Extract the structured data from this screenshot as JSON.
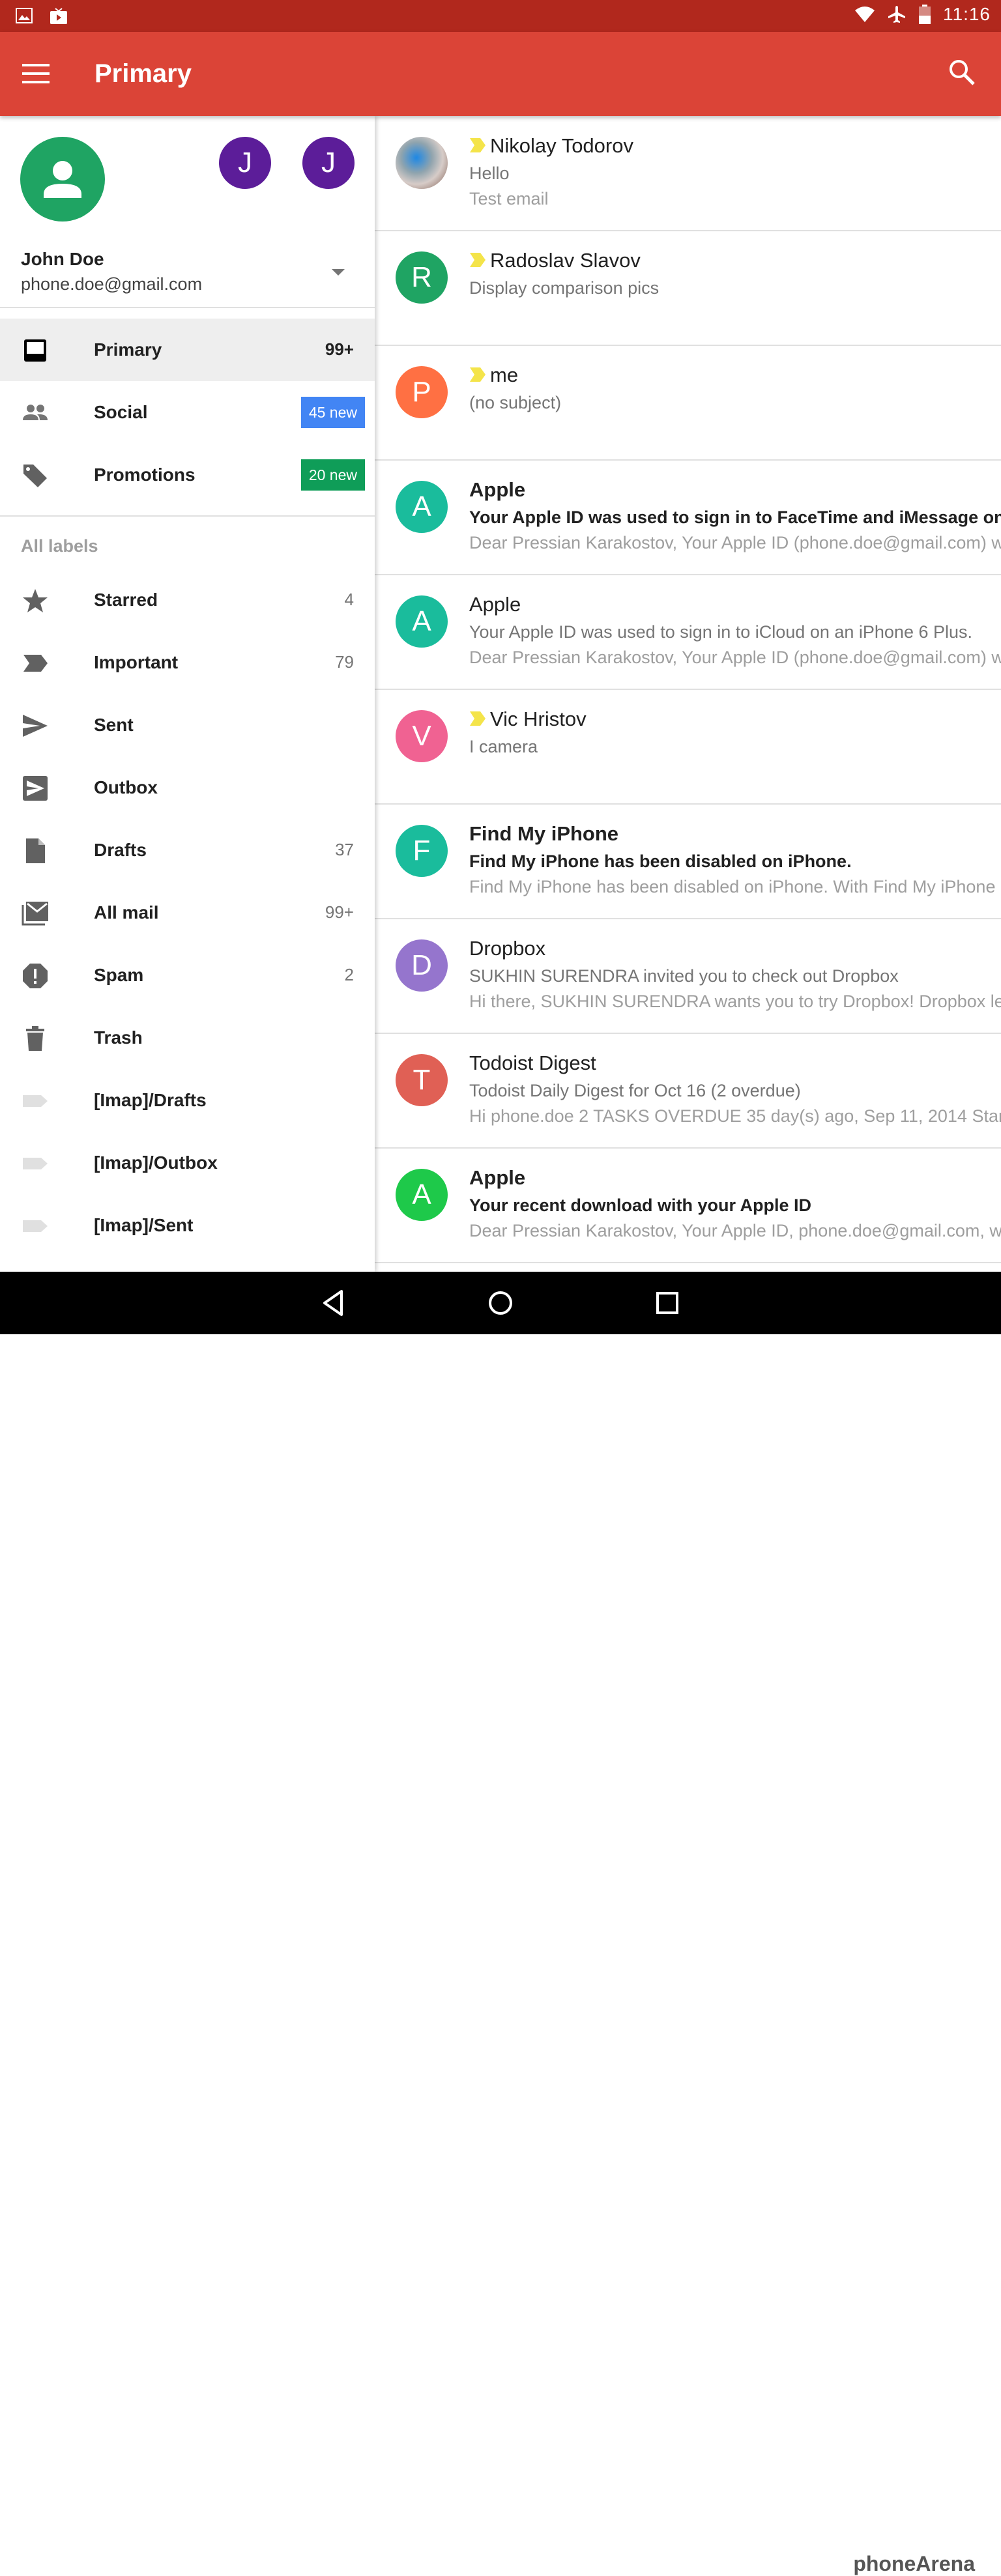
{
  "status_bar": {
    "time": "11:16"
  },
  "app_bar": {
    "title": "Primary"
  },
  "account": {
    "name": "John Doe",
    "email": "phone.doe@gmail.com",
    "other_accounts": [
      "J",
      "J"
    ]
  },
  "drawer": {
    "items": [
      {
        "label": "Primary",
        "count": "99+"
      },
      {
        "label": "Social",
        "badge": "45 new",
        "badge_color": "#4285f4"
      },
      {
        "label": "Promotions",
        "badge": "20 new",
        "badge_color": "#0f9d58"
      }
    ],
    "labels_header": "All labels",
    "labels": [
      {
        "label": "Starred",
        "count": "4",
        "icon": "star-icon"
      },
      {
        "label": "Important",
        "count": "79",
        "icon": "important-icon"
      },
      {
        "label": "Sent",
        "count": "",
        "icon": "send-icon"
      },
      {
        "label": "Outbox",
        "count": "",
        "icon": "outbox-icon"
      },
      {
        "label": "Drafts",
        "count": "37",
        "icon": "draft-icon"
      },
      {
        "label": "All mail",
        "count": "99+",
        "icon": "all-mail-icon"
      },
      {
        "label": "Spam",
        "count": "2",
        "icon": "spam-icon"
      },
      {
        "label": "Trash",
        "count": "",
        "icon": "trash-icon"
      },
      {
        "label": "[Imap]/Drafts",
        "count": "",
        "icon": "label-icon"
      },
      {
        "label": "[Imap]/Outbox",
        "count": "",
        "icon": "label-icon"
      },
      {
        "label": "[Imap]/Sent",
        "count": "",
        "icon": "label-icon"
      }
    ]
  },
  "messages": [
    {
      "sender": "Nikolay Todorov",
      "subject": "Hello",
      "snippet": "Test email",
      "important": true,
      "unread": false,
      "initial": "",
      "color": "#9e9e9e"
    },
    {
      "sender": "Radoslav Slavov",
      "subject": "Display comparison pics",
      "snippet": "",
      "important": true,
      "unread": false,
      "initial": "R",
      "color": "#1fa463"
    },
    {
      "sender": "me",
      "subject": "(no subject)",
      "snippet": "",
      "important": true,
      "unread": false,
      "initial": "P",
      "color": "#ff7043"
    },
    {
      "sender": "Apple",
      "subject": "Your Apple ID was used to sign in to FaceTime and iMessage on a",
      "snippet": "Dear Pressian Karakostov, Your Apple ID (phone.doe@gmail.com) w",
      "important": false,
      "unread": true,
      "initial": "A",
      "color": "#1abc9c"
    },
    {
      "sender": "Apple",
      "subject": "Your Apple ID was used to sign in to iCloud on an iPhone 6 Plus.",
      "snippet": "Dear Pressian Karakostov, Your Apple ID (phone.doe@gmail.com) w",
      "important": false,
      "unread": false,
      "initial": "A",
      "color": "#1abc9c"
    },
    {
      "sender": "Vic Hristov",
      "subject": "I camera",
      "snippet": "",
      "important": true,
      "unread": false,
      "initial": "V",
      "color": "#f06292"
    },
    {
      "sender": "Find My iPhone",
      "subject": "Find My iPhone has been disabled on iPhone.",
      "snippet": "Find My iPhone has been disabled on iPhone. With Find My iPhone d",
      "important": false,
      "unread": true,
      "initial": "F",
      "color": "#1abc9c"
    },
    {
      "sender": "Dropbox",
      "subject": "SUKHIN SURENDRA invited you to check out Dropbox",
      "snippet": "Hi there, SUKHIN SURENDRA wants you to try Dropbox! Dropbox le",
      "important": false,
      "unread": false,
      "initial": "D",
      "color": "#9575cd"
    },
    {
      "sender": "Todoist Digest",
      "subject": "Todoist Daily Digest for Oct 16 (2 overdue)",
      "snippet": "Hi phone.doe 2 TASKS OVERDUE 35 day(s) ago, Sep 11, 2014 Star",
      "important": false,
      "unread": false,
      "initial": "T",
      "color": "#e06055"
    },
    {
      "sender": "Apple",
      "subject": "Your recent download with your Apple ID",
      "snippet": "Dear Pressian Karakostov, Your Apple ID, phone.doe@gmail.com, w",
      "important": false,
      "unread": true,
      "initial": "A",
      "color": "#1ec94a"
    }
  ],
  "watermark": "phoneArena"
}
